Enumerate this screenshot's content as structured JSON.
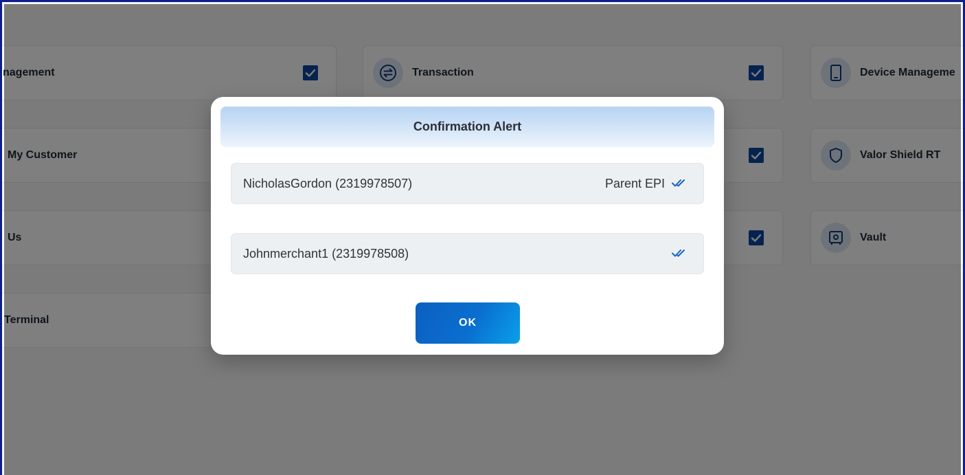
{
  "background": {
    "cards": [
      {
        "label": "nagement",
        "icon": "none",
        "checked": true
      },
      {
        "label": "Transaction",
        "icon": "transfer-icon",
        "checked": true
      },
      {
        "label": "Device Manageme",
        "icon": "tablet-icon",
        "checked": false
      },
      {
        "label": "My Customer",
        "icon": "none",
        "checked": false
      },
      {
        "label": "",
        "icon": "none",
        "checked": true
      },
      {
        "label": "Valor Shield RT",
        "icon": "shield-icon",
        "checked": false
      },
      {
        "label": "Us",
        "icon": "none",
        "checked": false
      },
      {
        "label": "",
        "icon": "none",
        "checked": true
      },
      {
        "label": "Vault",
        "icon": "vault-icon",
        "checked": false
      },
      {
        "label": "Terminal",
        "icon": "none",
        "checked": false
      }
    ]
  },
  "modal": {
    "title": "Confirmation Alert",
    "rows": [
      {
        "name": "NicholasGordon (2319978507)",
        "tag": "Parent EPI",
        "icon": "double-check-icon"
      },
      {
        "name": "Johnmerchant1 (2319978508)",
        "tag": "",
        "icon": "double-check-icon"
      }
    ],
    "ok_label": "OK"
  },
  "colors": {
    "frame_border": "#0b1f8f",
    "accent": "#0c5fc0",
    "checkbox": "#0d47a1",
    "overlay": "rgba(0,0,0,0.5)"
  }
}
